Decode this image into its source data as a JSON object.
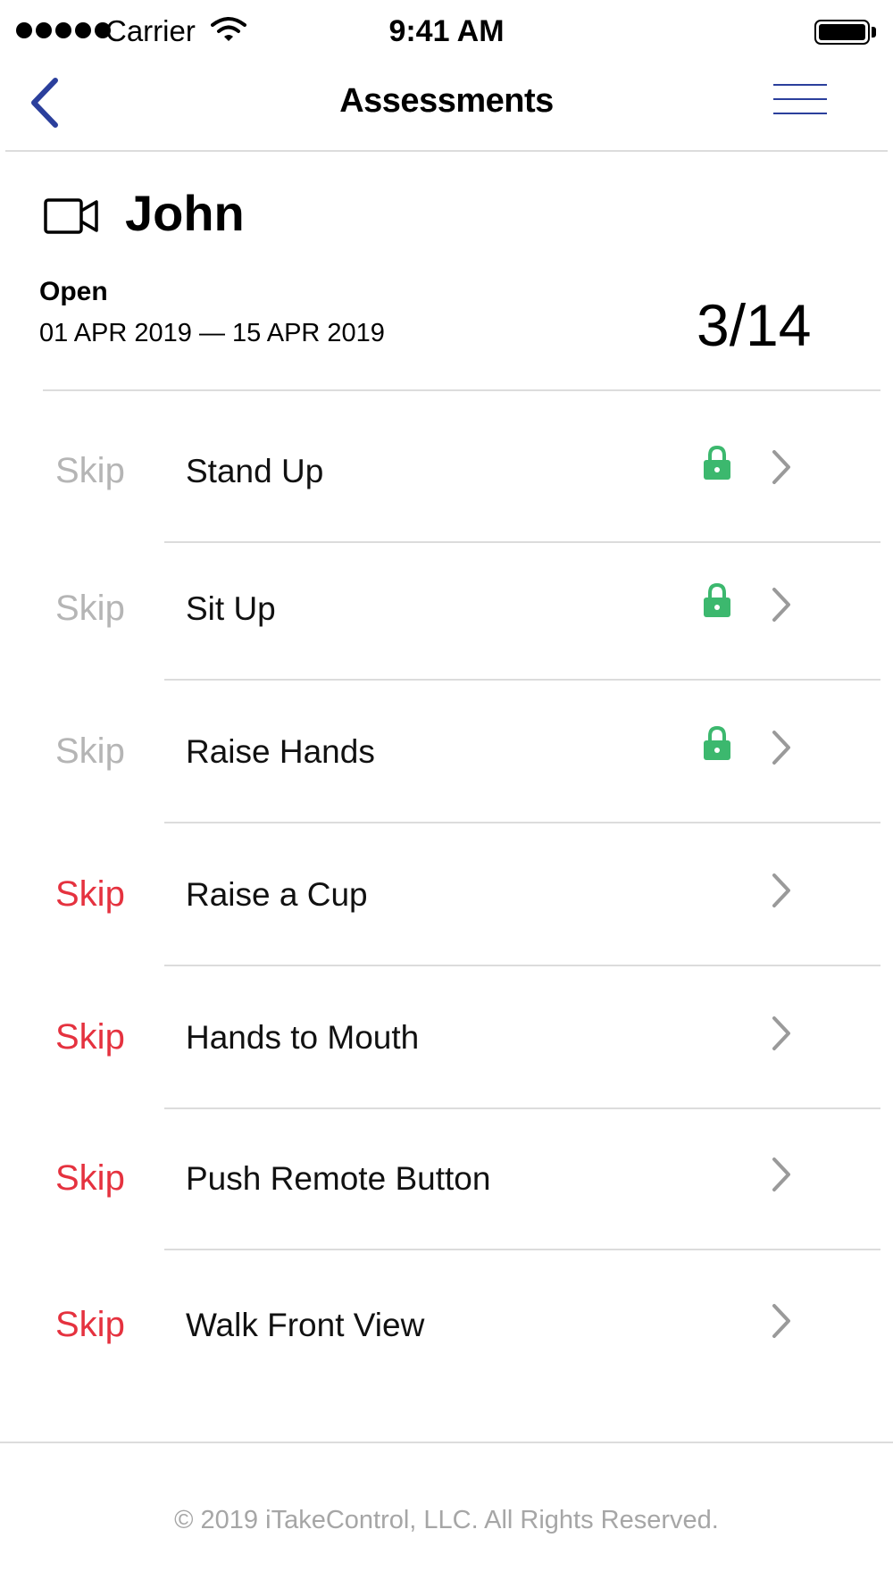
{
  "status_bar": {
    "carrier": "Carrier",
    "time": "9:41 AM",
    "signal_icon": "signal-dots-icon",
    "wifi_icon": "wifi-icon",
    "battery_icon": "battery-icon"
  },
  "nav": {
    "title": "Assessments",
    "back_icon": "chevron-left-icon",
    "menu_icon": "hamburger-menu-icon",
    "accent_color": "#2b3f9c"
  },
  "header": {
    "icon": "video-camera-icon",
    "name": "John",
    "status": "Open",
    "date_range": "01 APR 2019 — 15 APR 2019",
    "progress": "3/14"
  },
  "colors": {
    "skip_enabled": "#e5323f",
    "skip_disabled": "#b5b5b5",
    "lock": "#3cb86e"
  },
  "assessments": [
    {
      "skip_label": "Skip",
      "title": "Stand Up",
      "locked": true
    },
    {
      "skip_label": "Skip",
      "title": "Sit Up",
      "locked": true
    },
    {
      "skip_label": "Skip",
      "title": "Raise Hands",
      "locked": true
    },
    {
      "skip_label": "Skip",
      "title": "Raise a Cup",
      "locked": false
    },
    {
      "skip_label": "Skip",
      "title": "Hands to Mouth",
      "locked": false
    },
    {
      "skip_label": "Skip",
      "title": "Push Remote Button",
      "locked": false
    },
    {
      "skip_label": "Skip",
      "title": "Walk Front View",
      "locked": false
    }
  ],
  "footer": {
    "copyright": "© 2019 iTakeControl, LLC. All Rights Reserved."
  }
}
